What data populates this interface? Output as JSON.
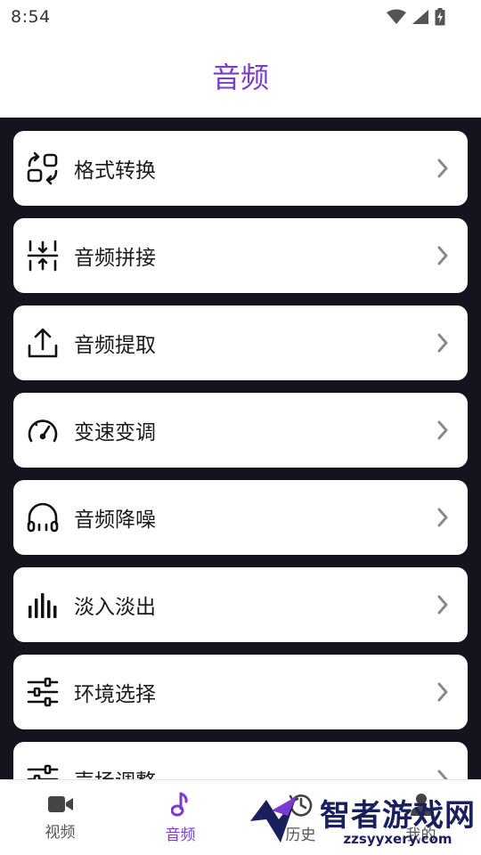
{
  "status": {
    "time": "8:54"
  },
  "header": {
    "title": "音频"
  },
  "menu": [
    {
      "label": "格式转换",
      "icon": "format-convert-icon"
    },
    {
      "label": "音频拼接",
      "icon": "audio-merge-icon"
    },
    {
      "label": "音频提取",
      "icon": "upload-icon"
    },
    {
      "label": "变速变调",
      "icon": "speedometer-icon"
    },
    {
      "label": "音频降噪",
      "icon": "headphones-icon"
    },
    {
      "label": "淡入淡出",
      "icon": "bar-chart-icon"
    },
    {
      "label": "环境选择",
      "icon": "sliders-icon"
    },
    {
      "label": "声场调整",
      "icon": "sliders-icon"
    }
  ],
  "tabs": [
    {
      "label": "视频",
      "icon": "video-camera-icon",
      "active": false
    },
    {
      "label": "音频",
      "icon": "music-note-icon",
      "active": true
    },
    {
      "label": "历史",
      "icon": "history-icon",
      "active": false
    },
    {
      "label": "我的",
      "icon": "user-icon",
      "active": false
    }
  ],
  "watermark": {
    "text": "智者游戏网",
    "domain": "zzsyyxery.com"
  },
  "colors": {
    "accent": "#7B3BD0",
    "background_dark": "#13141d"
  }
}
